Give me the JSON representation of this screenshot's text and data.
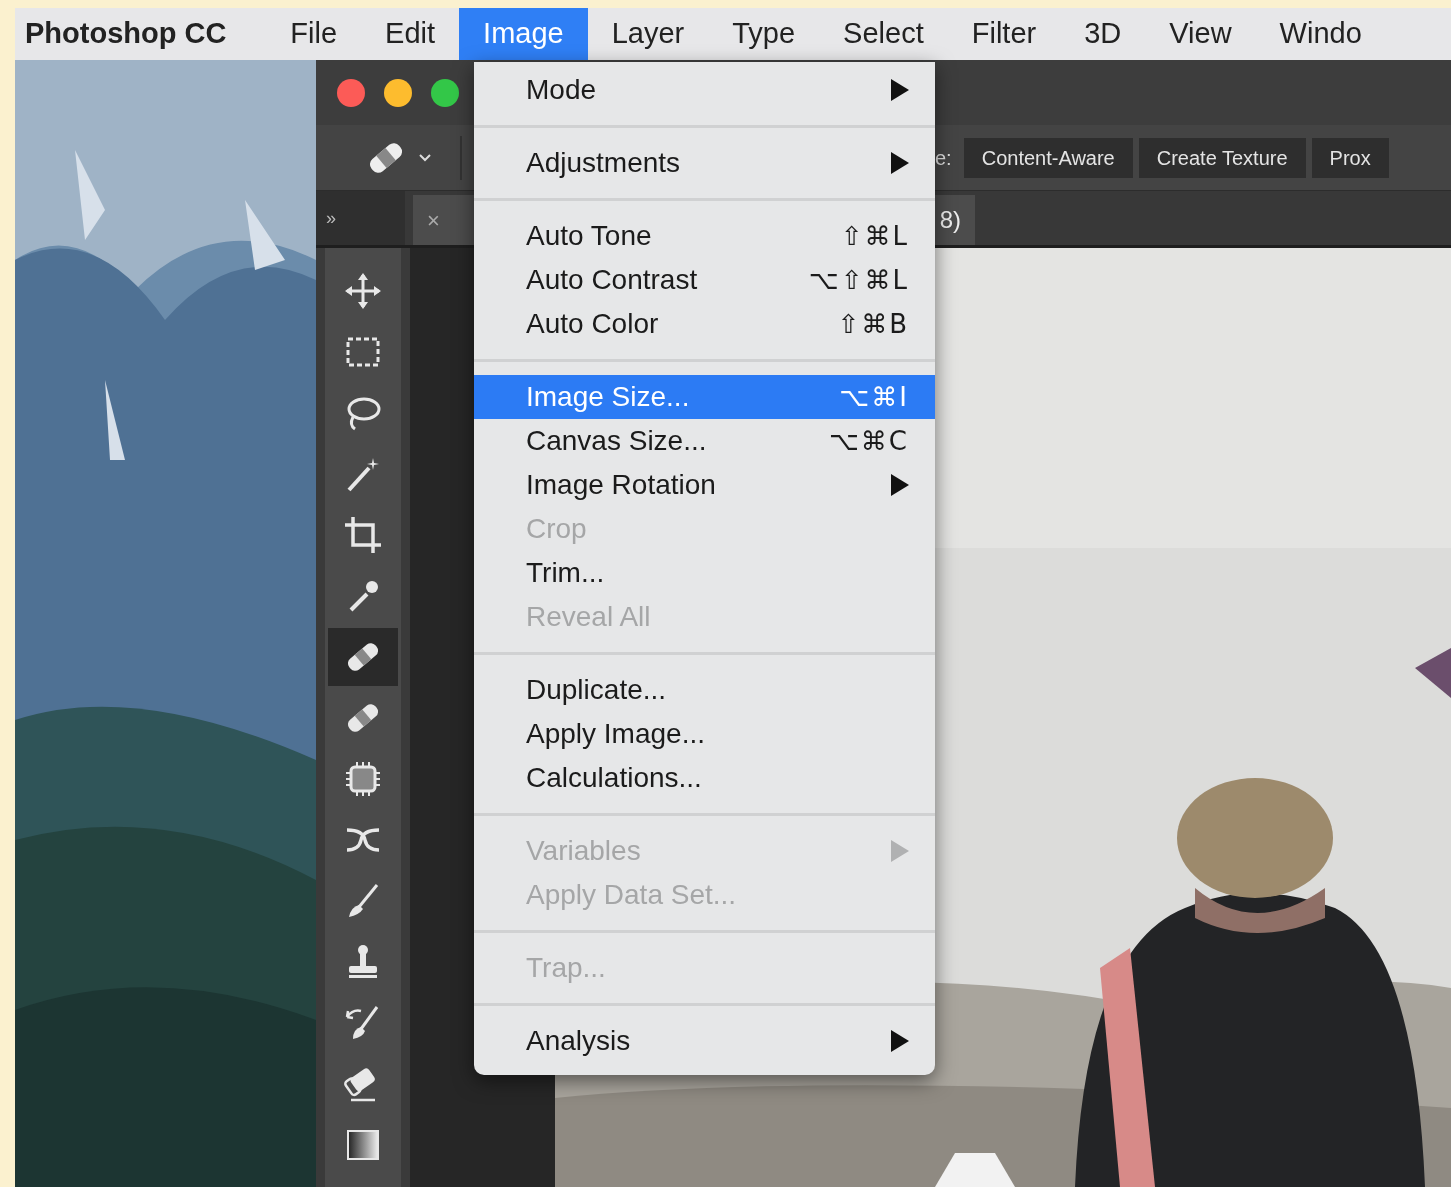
{
  "menubar": {
    "app": "Photoshop CC",
    "items": [
      {
        "label": "File",
        "selected": false
      },
      {
        "label": "Edit",
        "selected": false
      },
      {
        "label": "Image",
        "selected": true
      },
      {
        "label": "Layer",
        "selected": false
      },
      {
        "label": "Type",
        "selected": false
      },
      {
        "label": "Select",
        "selected": false
      },
      {
        "label": "Filter",
        "selected": false
      },
      {
        "label": "3D",
        "selected": false
      },
      {
        "label": "View",
        "selected": false
      },
      {
        "label": "Windo",
        "selected": false
      }
    ]
  },
  "options_bar": {
    "label": "e:",
    "buttons": [
      {
        "label": "Content-Aware",
        "selected": false
      },
      {
        "label": "Create Texture",
        "selected": false
      },
      {
        "label": "Prox",
        "selected": false
      }
    ]
  },
  "panel_toggle": "»",
  "document_tab": {
    "close": "×",
    "title": "8)"
  },
  "tools": [
    {
      "kind": "move",
      "selected": false
    },
    {
      "kind": "marquee",
      "selected": false
    },
    {
      "kind": "lasso",
      "selected": false
    },
    {
      "kind": "wand",
      "selected": false
    },
    {
      "kind": "crop",
      "selected": false
    },
    {
      "kind": "eyedropper",
      "selected": false
    },
    {
      "kind": "bandage",
      "selected": true
    },
    {
      "kind": "bandage",
      "selected": false
    },
    {
      "kind": "patch",
      "selected": false
    },
    {
      "kind": "cross",
      "selected": false
    },
    {
      "kind": "brush",
      "selected": false
    },
    {
      "kind": "stamp",
      "selected": false
    },
    {
      "kind": "history",
      "selected": false
    },
    {
      "kind": "eraser",
      "selected": false
    },
    {
      "kind": "gradient",
      "selected": false
    }
  ],
  "menu": [
    {
      "kind": "item",
      "label": "Mode",
      "submenu": true,
      "disabled": false,
      "selected": false
    },
    {
      "kind": "separator"
    },
    {
      "kind": "item",
      "label": "Adjustments",
      "submenu": true,
      "disabled": false,
      "selected": false
    },
    {
      "kind": "separator"
    },
    {
      "kind": "item",
      "label": "Auto Tone",
      "shortcut": "⇧⌘L",
      "submenu": false,
      "disabled": false,
      "selected": false
    },
    {
      "kind": "item",
      "label": "Auto Contrast",
      "shortcut": "⌥⇧⌘L",
      "submenu": false,
      "disabled": false,
      "selected": false
    },
    {
      "kind": "item",
      "label": "Auto Color",
      "shortcut": "⇧⌘B",
      "submenu": false,
      "disabled": false,
      "selected": false
    },
    {
      "kind": "separator"
    },
    {
      "kind": "item",
      "label": "Image Size...",
      "shortcut": "⌥⌘I",
      "submenu": false,
      "disabled": false,
      "selected": true
    },
    {
      "kind": "item",
      "label": "Canvas Size...",
      "shortcut": "⌥⌘C",
      "submenu": false,
      "disabled": false,
      "selected": false
    },
    {
      "kind": "item",
      "label": "Image Rotation",
      "submenu": true,
      "disabled": false,
      "selected": false
    },
    {
      "kind": "item",
      "label": "Crop",
      "submenu": false,
      "disabled": true,
      "selected": false
    },
    {
      "kind": "item",
      "label": "Trim...",
      "submenu": false,
      "disabled": false,
      "selected": false
    },
    {
      "kind": "item",
      "label": "Reveal All",
      "submenu": false,
      "disabled": true,
      "selected": false
    },
    {
      "kind": "separator"
    },
    {
      "kind": "item",
      "label": "Duplicate...",
      "submenu": false,
      "disabled": false,
      "selected": false
    },
    {
      "kind": "item",
      "label": "Apply Image...",
      "submenu": false,
      "disabled": false,
      "selected": false
    },
    {
      "kind": "item",
      "label": "Calculations...",
      "submenu": false,
      "disabled": false,
      "selected": false
    },
    {
      "kind": "separator"
    },
    {
      "kind": "item",
      "label": "Variables",
      "submenu": true,
      "disabled": true,
      "selected": false
    },
    {
      "kind": "item",
      "label": "Apply Data Set...",
      "submenu": false,
      "disabled": true,
      "selected": false
    },
    {
      "kind": "separator"
    },
    {
      "kind": "item",
      "label": "Trap...",
      "submenu": false,
      "disabled": true,
      "selected": false
    },
    {
      "kind": "separator"
    },
    {
      "kind": "item",
      "label": "Analysis",
      "submenu": true,
      "disabled": false,
      "selected": false
    }
  ]
}
